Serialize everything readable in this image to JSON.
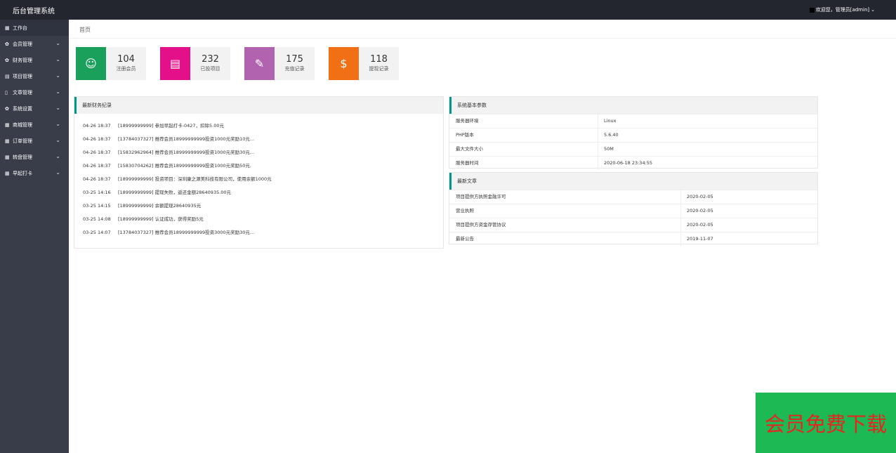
{
  "header": {
    "brand": "后台管理系统",
    "welcome": "欢迎您，管理员[admin]"
  },
  "sidebar": {
    "items": [
      {
        "label": "工作台",
        "icon": "grid-icon",
        "glyph": "▦",
        "has_chevron": false
      },
      {
        "label": "会员管理",
        "icon": "gear-icon",
        "glyph": "✿",
        "has_chevron": true
      },
      {
        "label": "财务管理",
        "icon": "gear-icon",
        "glyph": "✿",
        "has_chevron": true
      },
      {
        "label": "项目管理",
        "icon": "list-icon",
        "glyph": "▤",
        "has_chevron": true
      },
      {
        "label": "文章管理",
        "icon": "document-icon",
        "glyph": "▯",
        "has_chevron": true
      },
      {
        "label": "系统设置",
        "icon": "gear-icon",
        "glyph": "✿",
        "has_chevron": true
      },
      {
        "label": "商城管理",
        "icon": "grid-icon",
        "glyph": "▦",
        "has_chevron": true
      },
      {
        "label": "订单管理",
        "icon": "grid-icon",
        "glyph": "▦",
        "has_chevron": true
      },
      {
        "label": "转盘管理",
        "icon": "grid-icon",
        "glyph": "▦",
        "has_chevron": true
      },
      {
        "label": "早起打卡",
        "icon": "grid-icon",
        "glyph": "▦",
        "has_chevron": true
      }
    ]
  },
  "breadcrumb": {
    "label": "首页"
  },
  "stats": [
    {
      "value": "104",
      "label": "注册会员",
      "color": "#1aa05b",
      "icon": "user-icon",
      "glyph": "☺"
    },
    {
      "value": "232",
      "label": "已投项目",
      "color": "#e4108a",
      "icon": "clipboard-icon",
      "glyph": "▤"
    },
    {
      "value": "175",
      "label": "充值记录",
      "color": "#b163b0",
      "icon": "edit-icon",
      "glyph": "✎"
    },
    {
      "value": "118",
      "label": "提现记录",
      "color": "#f17015",
      "icon": "money-bag-icon",
      "glyph": "$"
    }
  ],
  "finance": {
    "title": "最新财务纪录",
    "rows": [
      {
        "time": "04-26 18:37",
        "text": "[18999999999] 参加早起打卡-0427，扣除5.00元"
      },
      {
        "time": "04-26 18:37",
        "text": "[13784037327] 推荐会员18999999999投资1000元奖励10元..."
      },
      {
        "time": "04-26 18:37",
        "text": "[15832962964] 推荐会员18999999999投资1000元奖励30元..."
      },
      {
        "time": "04-26 18:37",
        "text": "[15830704262] 推荐会员18999999999投资1000元奖励50元."
      },
      {
        "time": "04-26 18:37",
        "text": "[18999999999] 投资项目：深圳康之源美科技有限公司，使用余额1000元"
      },
      {
        "time": "03-25 14:16",
        "text": "[18999999999] 提现失败，返还金额28640935.00元"
      },
      {
        "time": "03-25 14:15",
        "text": "[18999999999] 余额提现28640935元"
      },
      {
        "time": "03-25 14:08",
        "text": "[18999999999] 认证成功，获得奖励5元"
      },
      {
        "time": "03-25 14:07",
        "text": "[13784037327] 推荐会员18999999999投资3000元奖励30元..."
      }
    ]
  },
  "system": {
    "title": "系统基本参数",
    "rows": [
      {
        "key": "服务器环境",
        "value": "Linux"
      },
      {
        "key": "PHP版本",
        "value": "5.6.40"
      },
      {
        "key": "最大文件大小",
        "value": "50M"
      },
      {
        "key": "服务器时间",
        "value": "2020-06-18 23:34:55"
      }
    ]
  },
  "articles": {
    "title": "最新文章",
    "rows": [
      {
        "key": "项目提供方执照金融许可",
        "value": "2020-02-05"
      },
      {
        "key": "营业执照",
        "value": "2020-02-05"
      },
      {
        "key": "项目提供方资金存管协议",
        "value": "2020-02-05"
      },
      {
        "key": "最新公告",
        "value": "2019-11-07"
      }
    ]
  },
  "promo": {
    "label": "会员免费下载"
  }
}
